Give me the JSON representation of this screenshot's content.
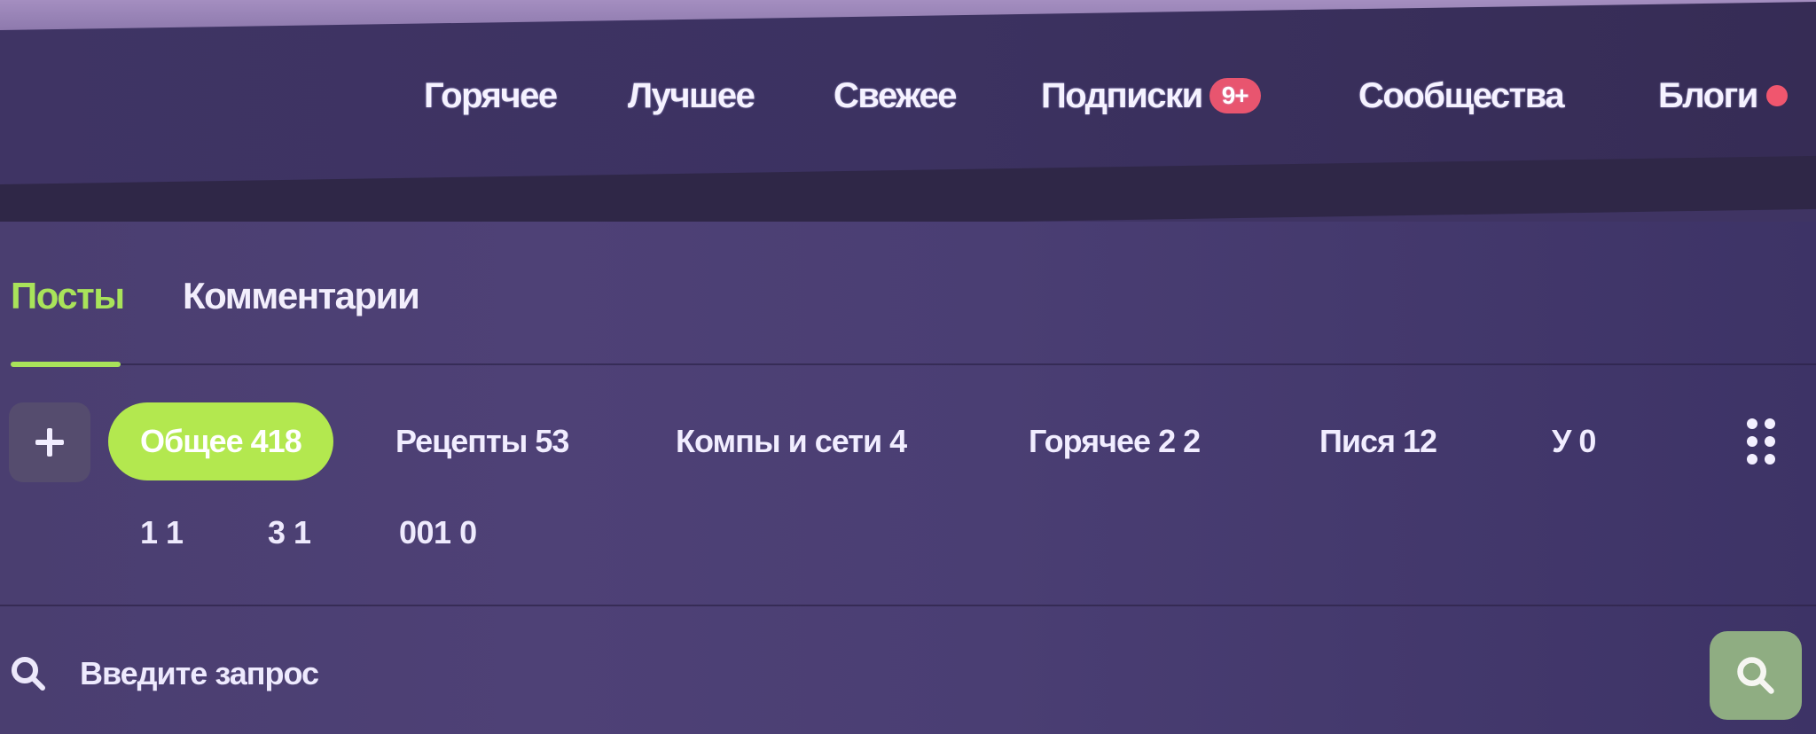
{
  "header": {
    "nav": [
      {
        "label": "Горячее"
      },
      {
        "label": "Лучшее"
      },
      {
        "label": "Свежее"
      },
      {
        "label": "Подписки",
        "badge": "9+"
      },
      {
        "label": "Сообщества"
      },
      {
        "label": "Блоги",
        "dot": true
      }
    ]
  },
  "tabs": [
    {
      "label": "Посты",
      "active": true
    },
    {
      "label": "Комментарии",
      "active": false
    }
  ],
  "filters": {
    "add_icon": "plus-icon",
    "more_icon": "grid-dots-icon",
    "chips": [
      {
        "label": "Общее 418",
        "active": true
      },
      {
        "label": "Рецепты 53"
      },
      {
        "label": "Компы и сети 4"
      },
      {
        "label": "Горячее 2 2"
      },
      {
        "label": "Пися 12"
      },
      {
        "label": "У 0"
      }
    ],
    "second_row": [
      {
        "label": "1 1"
      },
      {
        "label": "3 1"
      },
      {
        "label": "001 0"
      }
    ]
  },
  "search": {
    "placeholder": "Введите запрос",
    "value": "",
    "icon": "search-icon",
    "button_icon": "search-icon"
  },
  "colors": {
    "accent": "#a9e35a",
    "badge": "#e8556f",
    "search_button": "#8fad82",
    "background": "#3f3463"
  }
}
